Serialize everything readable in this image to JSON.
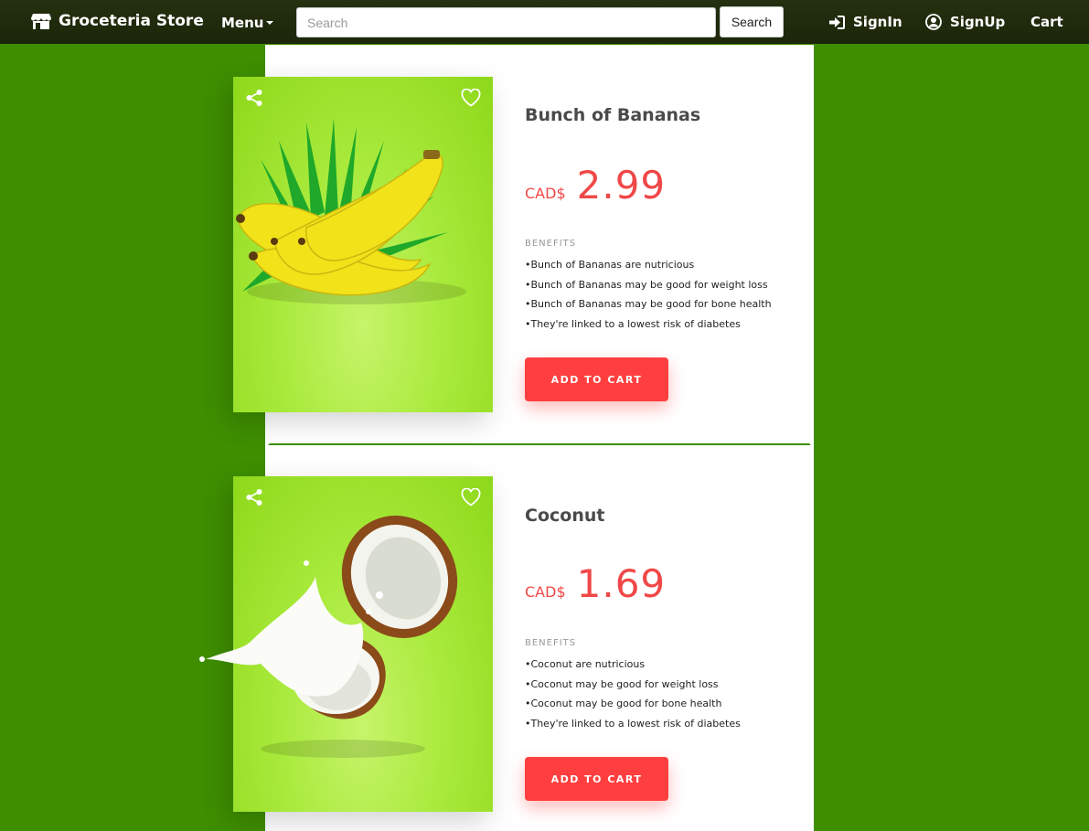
{
  "nav": {
    "brand": "Groceteria Store",
    "menu_label": "Menu",
    "search_placeholder": "Search",
    "search_button": "Search",
    "signin": "SignIn",
    "signup": "SignUp",
    "cart": "Cart"
  },
  "products": [
    {
      "name": "Bunch of Bananas",
      "currency": "CAD$",
      "price": "2.99",
      "benefits_label": "BENEFITS",
      "benefits": [
        "•Bunch of Bananas are nutricious",
        "•Bunch of Bananas may be good for weight loss",
        "•Bunch of Bananas may be good for bone health",
        "•They're linked to a lowest risk of diabetes"
      ],
      "button": "ADD TO CART"
    },
    {
      "name": "Coconut",
      "currency": "CAD$",
      "price": "1.69",
      "benefits_label": "BENEFITS",
      "benefits": [
        "•Coconut are nutricious",
        "•Coconut may be good for weight loss",
        "•Coconut may be good for bone health",
        "•They're linked to a lowest risk of diabetes"
      ],
      "button": "ADD TO CART"
    }
  ],
  "colors": {
    "page_bg": "#3e8e00",
    "navbar": "#1f2b0a",
    "accent": "#ff3f3f",
    "image_bg": "#a9ea3c"
  },
  "icons": [
    "store-icon",
    "sign-in-icon",
    "user-circle-icon",
    "share-icon",
    "heart-icon"
  ]
}
